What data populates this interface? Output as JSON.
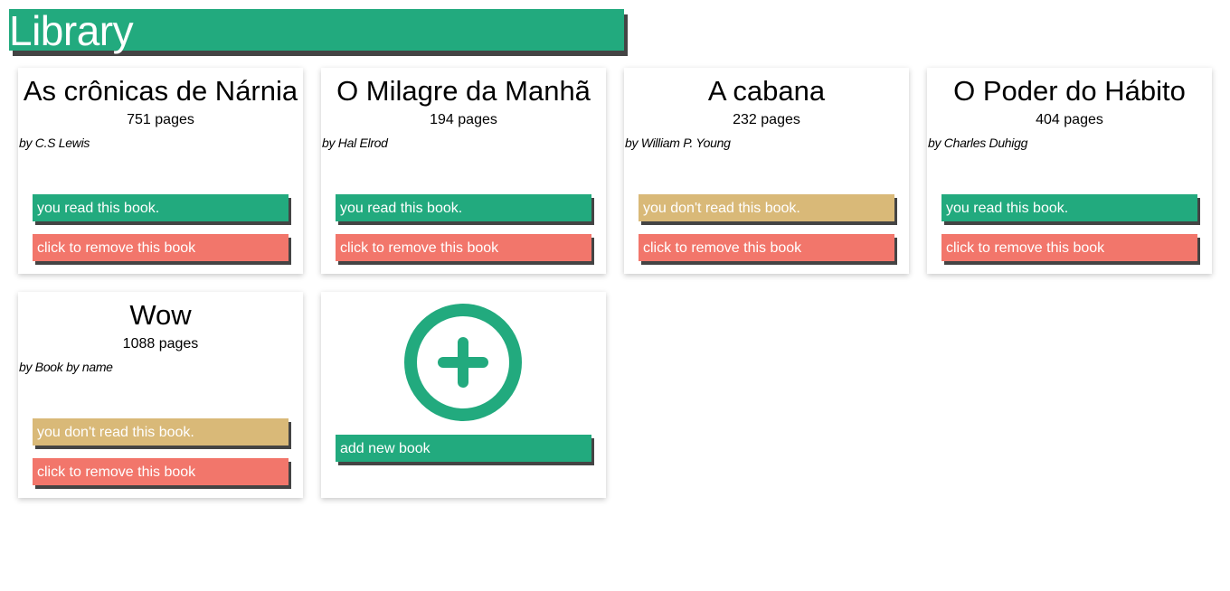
{
  "header": {
    "title": "Library"
  },
  "colors": {
    "accent": "#22aa7e",
    "read": "#22aa7e",
    "unread": "#d9b978",
    "remove": "#f2766b",
    "shadow": "#444444"
  },
  "books": [
    {
      "title": "As crônicas de Nárnia",
      "pages": "751 pages",
      "author": "by C.S Lewis",
      "status": "you read this book.",
      "read": true,
      "remove": "click to remove this book"
    },
    {
      "title": "O Milagre da Manhã",
      "pages": "194 pages",
      "author": "by Hal Elrod",
      "status": "you read this book.",
      "read": true,
      "remove": "click to remove this book"
    },
    {
      "title": "A cabana",
      "pages": "232 pages",
      "author": "by William P. Young",
      "status": "you don't read this book.",
      "read": false,
      "remove": "click to remove this book"
    },
    {
      "title": "O Poder do Hábito",
      "pages": "404 pages",
      "author": "by Charles Duhigg",
      "status": "you read this book.",
      "read": true,
      "remove": "click to remove this book"
    },
    {
      "title": "Wow",
      "pages": "1088 pages",
      "author": "by Book by name",
      "status": "you don't read this book.",
      "read": false,
      "remove": "click to remove this book"
    }
  ],
  "add_card": {
    "icon": "plus-circle-icon",
    "label": "add new book"
  }
}
